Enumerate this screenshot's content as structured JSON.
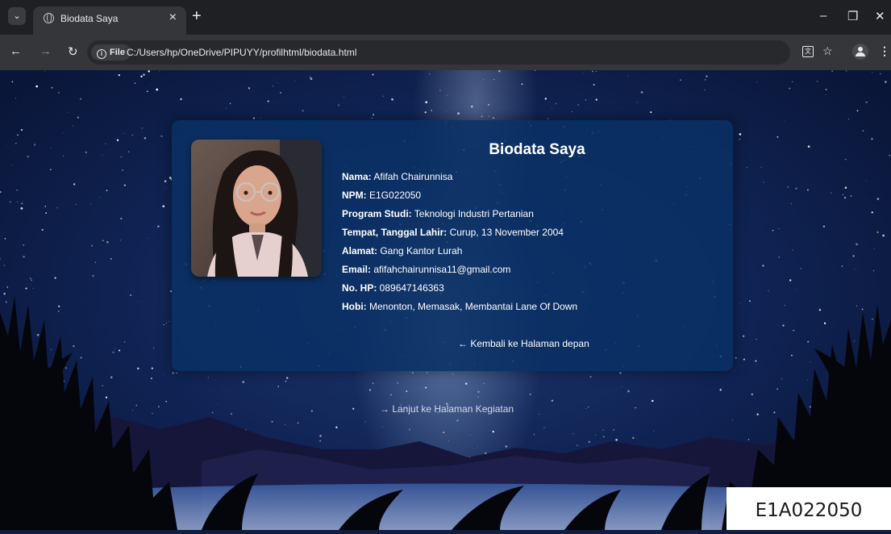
{
  "browser": {
    "tab_title": "Biodata Saya",
    "new_tab": "+",
    "address_chip": "File",
    "url": "C:/Users/hp/OneDrive/PIPUYY/profilhtml/biodata.html"
  },
  "page": {
    "card_title": "Biodata Saya",
    "fields": [
      {
        "label": "Nama:",
        "value": " Afifah Chairunnisa"
      },
      {
        "label": "NPM:",
        "value": " E1G022050"
      },
      {
        "label": "Program Studi:",
        "value": " Teknologi Industri Pertanian"
      },
      {
        "label": "Tempat, Tanggal Lahir:",
        "value": " Curup, 13 November 2004"
      },
      {
        "label": "Alamat:",
        "value": " Gang Kantor Lurah"
      },
      {
        "label": "Email:",
        "value": " afifahchairunnisa11@gmail.com"
      },
      {
        "label": "No. HP:",
        "value": " 089647146363"
      },
      {
        "label": "Hobi:",
        "value": " Menonton, Memasak, Membantai Lane Of Down"
      }
    ],
    "back_link": "← Kembali ke Halaman depan",
    "next_link": "→ Lanjut ke Halaman Kegiatan"
  },
  "watermark": "E1A022050",
  "colors": {
    "card_bg": "#0a3064",
    "chrome_tabbar": "#1f2023",
    "chrome_toolbar": "#35363a"
  }
}
